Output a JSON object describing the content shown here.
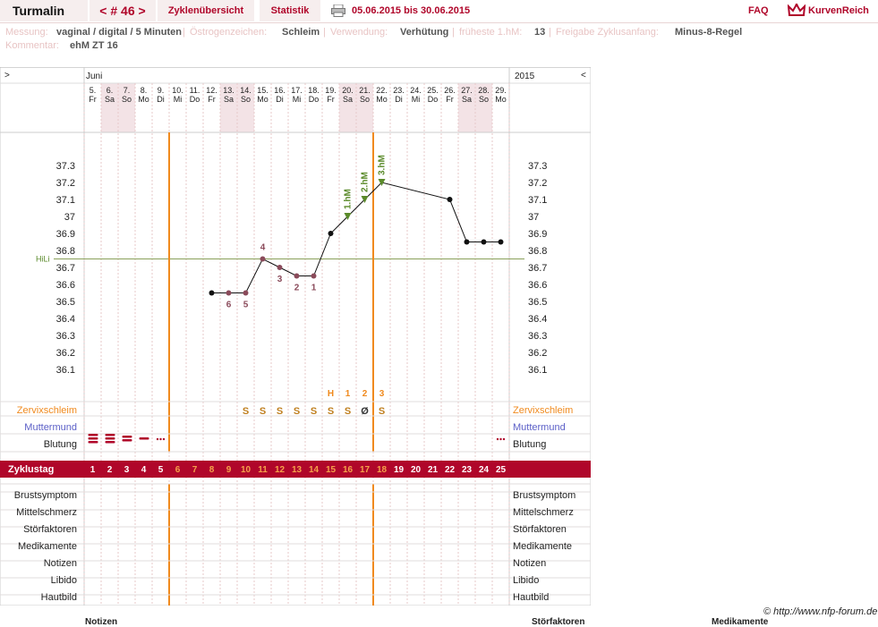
{
  "app": {
    "title": "Turmalin",
    "cycle_nav": "< # 46 >",
    "overview": "Zyklenübersicht",
    "statistics": "Statistik",
    "daterange": "05.06.2015 bis 30.06.2015",
    "faq": "FAQ",
    "logo": "KurvenReich"
  },
  "info": {
    "mess_label": "Messung:",
    "mess_value": "vaginal / digital / 5 Minuten",
    "oe_label": "Östrogenzeichen:",
    "oe_value": "Schleim",
    "verw_label": "Verwendung:",
    "verw_value": "Verhütung",
    "hm_label": "früheste 1.hM:",
    "hm_value": "13",
    "fz_label": "Freigabe Zyklusanfang:",
    "fz_value": "Minus-8-Regel",
    "kom_label": "Kommentar:",
    "kom_value": "ehM ZT 16"
  },
  "calendar": {
    "month": "Juni",
    "year": "2015",
    "nav_left": ">",
    "nav_right": "<",
    "dates": [
      "5.",
      "6.",
      "7.",
      "8.",
      "9.",
      "10.",
      "11.",
      "12.",
      "13.",
      "14.",
      "15.",
      "16.",
      "17.",
      "18.",
      "19.",
      "20.",
      "21.",
      "22.",
      "23.",
      "24.",
      "25.",
      "26.",
      "27.",
      "28.",
      "29."
    ],
    "weekdays": [
      "Fr",
      "Sa",
      "So",
      "Mo",
      "Di",
      "Mi",
      "Do",
      "Fr",
      "Sa",
      "So",
      "Mo",
      "Di",
      "Mi",
      "Do",
      "Fr",
      "Sa",
      "So",
      "Mo",
      "Di",
      "Mi",
      "Do",
      "Fr",
      "Sa",
      "So",
      "Mo"
    ],
    "weekend_indices": [
      1,
      2,
      8,
      9,
      15,
      16,
      22,
      23
    ]
  },
  "chart_data": {
    "type": "line",
    "title": "",
    "xlabel": "Zyklustag",
    "ylabel": "",
    "ylim": [
      36.0,
      37.4
    ],
    "y_ticks": [
      "37.3",
      "37.2",
      "37.1",
      "37",
      "36.9",
      "36.8",
      "36.7",
      "36.6",
      "36.5",
      "36.4",
      "36.3",
      "36.2",
      "36.1"
    ],
    "coverline": {
      "label": "HiLi",
      "value": 36.75
    },
    "x": [
      8,
      9,
      10,
      11,
      12,
      13,
      14,
      15,
      16,
      17,
      18,
      19,
      23,
      24,
      25
    ],
    "values": [
      36.55,
      36.55,
      36.55,
      36.75,
      36.7,
      36.65,
      36.65,
      36.9,
      37.0,
      37.1,
      37.2,
      null,
      37.1,
      36.85,
      36.85
    ],
    "series": [
      {
        "name": "",
        "x": [
          8,
          9,
          10,
          11,
          12,
          13,
          14,
          15,
          16,
          17,
          18,
          22,
          23,
          24,
          25
        ],
        "values": [
          36.55,
          36.55,
          36.55,
          36.75,
          36.7,
          36.65,
          36.65,
          36.9,
          37.0,
          37.1,
          37.2,
          37.1,
          36.85,
          36.85,
          36.85
        ]
      }
    ],
    "cycle_days": [
      "1",
      "2",
      "3",
      "4",
      "5",
      "6",
      "7",
      "8",
      "9",
      "10",
      "11",
      "12",
      "13",
      "14",
      "15",
      "16",
      "17",
      "18",
      "19",
      "20",
      "21",
      "22",
      "23",
      "24",
      "25"
    ],
    "low_labels": [
      {
        "day": 9,
        "text": "6"
      },
      {
        "day": 10,
        "text": "5"
      },
      {
        "day": 11,
        "text": "4"
      },
      {
        "day": 12,
        "text": "3"
      },
      {
        "day": 13,
        "text": "2"
      },
      {
        "day": 14,
        "text": "1"
      }
    ],
    "high_labels": [
      {
        "day": 16,
        "text": "1.hM"
      },
      {
        "day": 17,
        "text": "2.hM"
      },
      {
        "day": 18,
        "text": "3.hM"
      }
    ],
    "mucus_peak": [
      {
        "day": 15,
        "text": "H"
      },
      {
        "day": 16,
        "text": "1"
      },
      {
        "day": 17,
        "text": "2"
      },
      {
        "day": 18,
        "text": "3"
      }
    ],
    "mucus": [
      {
        "day": 10,
        "text": "S"
      },
      {
        "day": 11,
        "text": "S"
      },
      {
        "day": 12,
        "text": "S"
      },
      {
        "day": 13,
        "text": "S"
      },
      {
        "day": 14,
        "text": "S"
      },
      {
        "day": 15,
        "text": "S"
      },
      {
        "day": 16,
        "text": "S"
      },
      {
        "day": 17,
        "text": "Ø"
      },
      {
        "day": 18,
        "text": "S"
      }
    ],
    "bleeding": [
      {
        "day": 1,
        "level": "3"
      },
      {
        "day": 2,
        "level": "3"
      },
      {
        "day": 3,
        "level": "2"
      },
      {
        "day": 4,
        "level": "1"
      },
      {
        "day": 5,
        "level": "spot"
      },
      {
        "day": 25,
        "level": "spot"
      }
    ],
    "markers": {
      "first_day_after_bleeding": 6,
      "ovulation_end": 18
    },
    "legend_position": "none",
    "grid": true
  },
  "rows": {
    "mucus": "Zervixschleim",
    "cervix": "Muttermund",
    "bleeding": "Blutung",
    "cycleday": "Zyklustag",
    "breast": "Brustsymptom",
    "midpain": "Mittelschmerz",
    "disturb": "Störfaktoren",
    "medic": "Medikamente",
    "notes": "Notizen",
    "libido": "Libido",
    "skin": "Hautbild"
  },
  "footer": {
    "url": "© http://www.nfp-forum.de",
    "notes": "Notizen",
    "stoer": "Störfaktoren",
    "medik": "Medikamente"
  },
  "colors": {
    "accent": "#b0062a",
    "orange": "#f08a1e",
    "green": "#5a8a2a",
    "weekend": "#f3e3e6"
  }
}
